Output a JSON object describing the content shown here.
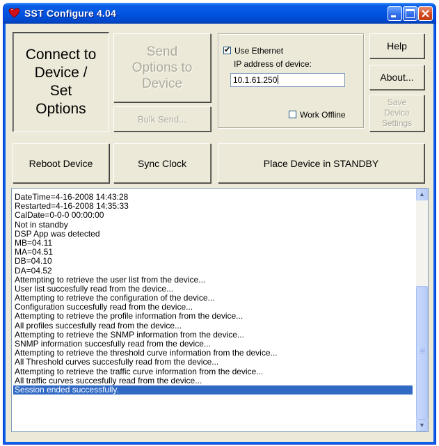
{
  "window": {
    "title": "SST Configure 4.04"
  },
  "buttons": {
    "connect": "Connect to\nDevice /\nSet\nOptions",
    "send_options": "Send\nOptions to\nDevice",
    "bulk_send": "Bulk Send...",
    "help": "Help",
    "about": "About...",
    "save_device_settings": "Save\nDevice\nSettings",
    "reboot": "Reboot Device",
    "sync_clock": "Sync Clock",
    "standby": "Place Device in STANDBY"
  },
  "ethernet": {
    "use_ethernet_label": "Use Ethernet",
    "use_ethernet_checked": true,
    "ip_label": "IP address of device:",
    "ip_value": "10.1.61.250",
    "work_offline_label": "Work Offline",
    "work_offline_checked": false
  },
  "log": {
    "lines": [
      "DateTime=4-16-2008 14:43:28",
      "Restarted=4-16-2008 14:35:33",
      "CalDate=0-0-0 00:00:00",
      "Not in standby",
      "DSP App was detected",
      "MB=04.11",
      "MA=04.51",
      "DB=04.10",
      "DA=04.52",
      "Attempting to retrieve the user list from the device...",
      "User list succesfully read from the device...",
      "Attempting to retrieve the configuration of the device...",
      "Configuration succesfully read from the device...",
      "Attempting to retrieve the profile information from the device...",
      "All profiles succesfully read from the device...",
      "Attempting to retrieve the SNMP information from the device...",
      "SNMP information succesfully read from the device...",
      "Attempting to retrieve the threshold curve information from the device...",
      "All Threshold curves succesfully read from the device...",
      "Attempting to retrieve the traffic curve information from the device...",
      "All traffic curves succesfully read from the device...",
      "Session ended successfully."
    ],
    "selected_index": 21
  },
  "colors": {
    "titlebar": "#0053E1",
    "selection": "#316AC5",
    "face": "#ECE9D8"
  }
}
